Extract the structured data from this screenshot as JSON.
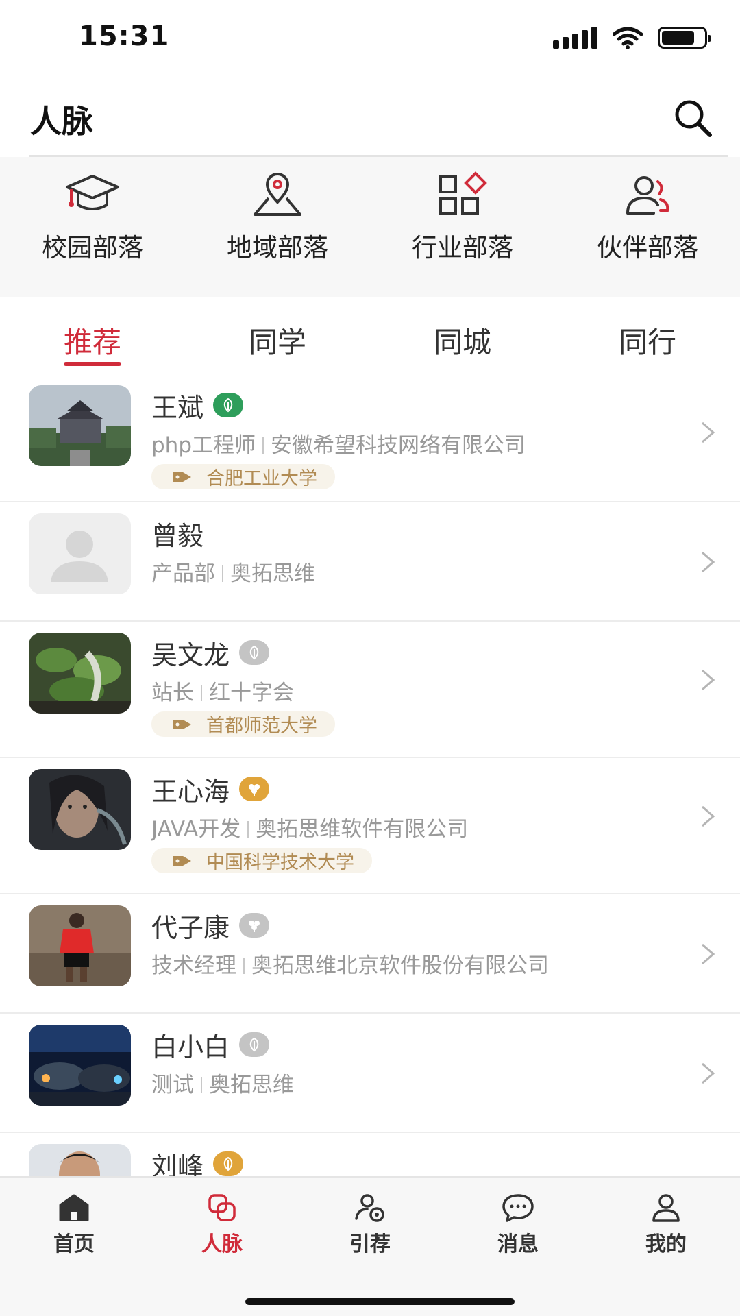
{
  "status_bar": {
    "time": "15:31"
  },
  "header": {
    "title": "人脉"
  },
  "tribes": [
    {
      "label": "校园部落",
      "icon": "graduation-cap-icon"
    },
    {
      "label": "地域部落",
      "icon": "map-pin-icon"
    },
    {
      "label": "行业部落",
      "icon": "category-grid-icon"
    },
    {
      "label": "伙伴部落",
      "icon": "partners-icon"
    }
  ],
  "tabs": [
    {
      "label": "推荐",
      "active": true
    },
    {
      "label": "同学",
      "active": false
    },
    {
      "label": "同城",
      "active": false
    },
    {
      "label": "同行",
      "active": false
    }
  ],
  "contacts": [
    {
      "name": "王斌",
      "badge": "green-leaf",
      "title": "php工程师",
      "company": "安徽希望科技网络有限公司",
      "school": "合肥工业大学"
    },
    {
      "name": "曾毅",
      "badge": "",
      "title": "产品部",
      "company": "奥拓思维",
      "school": ""
    },
    {
      "name": "吴文龙",
      "badge": "grey-leaf",
      "title": "站长",
      "company": "红十字会",
      "school": "首都师范大学"
    },
    {
      "name": "王心海",
      "badge": "gold-clover",
      "title": "JAVA开发",
      "company": "奥拓思维软件有限公司",
      "school": "中国科学技术大学"
    },
    {
      "name": "代子康",
      "badge": "grey-clover",
      "title": "技术经理",
      "company": "奥拓思维北京软件股份有限公司",
      "school": ""
    },
    {
      "name": "白小白",
      "badge": "grey-leaf",
      "title": "测试",
      "company": "奥拓思维",
      "school": ""
    },
    {
      "name": "刘峰",
      "badge": "gold-leaf",
      "title": "",
      "company": "",
      "school": ""
    }
  ],
  "bottom_nav": [
    {
      "label": "首页",
      "icon": "home-icon",
      "active": false
    },
    {
      "label": "人脉",
      "icon": "connections-icon",
      "active": true
    },
    {
      "label": "引荐",
      "icon": "referral-icon",
      "active": false
    },
    {
      "label": "消息",
      "icon": "message-icon",
      "active": false
    },
    {
      "label": "我的",
      "icon": "profile-icon",
      "active": false
    }
  ],
  "colors": {
    "accent": "#d02b3a",
    "tag_text": "#b18b53",
    "tag_bg": "#f7f3ea",
    "green_badge": "#2e9e5b",
    "gold_badge": "#e0a43a",
    "grey_badge": "#c4c4c4"
  }
}
